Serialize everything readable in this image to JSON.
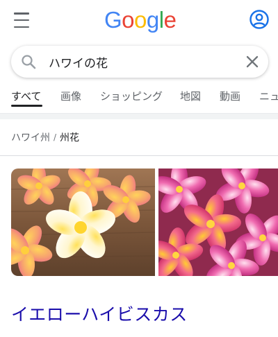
{
  "header": {
    "logo_letters": [
      {
        "char": "G",
        "color": "#4285F4"
      },
      {
        "char": "o",
        "color": "#EA4335"
      },
      {
        "char": "o",
        "color": "#FBBC05"
      },
      {
        "char": "g",
        "color": "#4285F4"
      },
      {
        "char": "l",
        "color": "#34A853"
      },
      {
        "char": "e",
        "color": "#EA4335"
      }
    ],
    "menu_icon": "hamburger-icon",
    "account_icon": "account-circle-icon",
    "accent": "#1a73e8"
  },
  "search": {
    "value": "ハワイの花",
    "search_icon": "search-icon",
    "clear_icon": "close-icon"
  },
  "tabs": [
    {
      "label": "すべて",
      "active": true
    },
    {
      "label": "画像",
      "active": false
    },
    {
      "label": "ショッピング",
      "active": false
    },
    {
      "label": "地図",
      "active": false
    },
    {
      "label": "動画",
      "active": false
    },
    {
      "label": "ニュ",
      "active": false
    }
  ],
  "breadcrumb": {
    "parent": "ハワイ州",
    "separator": "/",
    "current": "州花"
  },
  "images": [
    {
      "subject": "white-yellow plumeria and pink plumeria on wooden table"
    },
    {
      "subject": "pink and red plumeria flowers pile"
    }
  ],
  "result": {
    "title": "イエローハイビスカス",
    "title_color": "#1a0dab"
  }
}
